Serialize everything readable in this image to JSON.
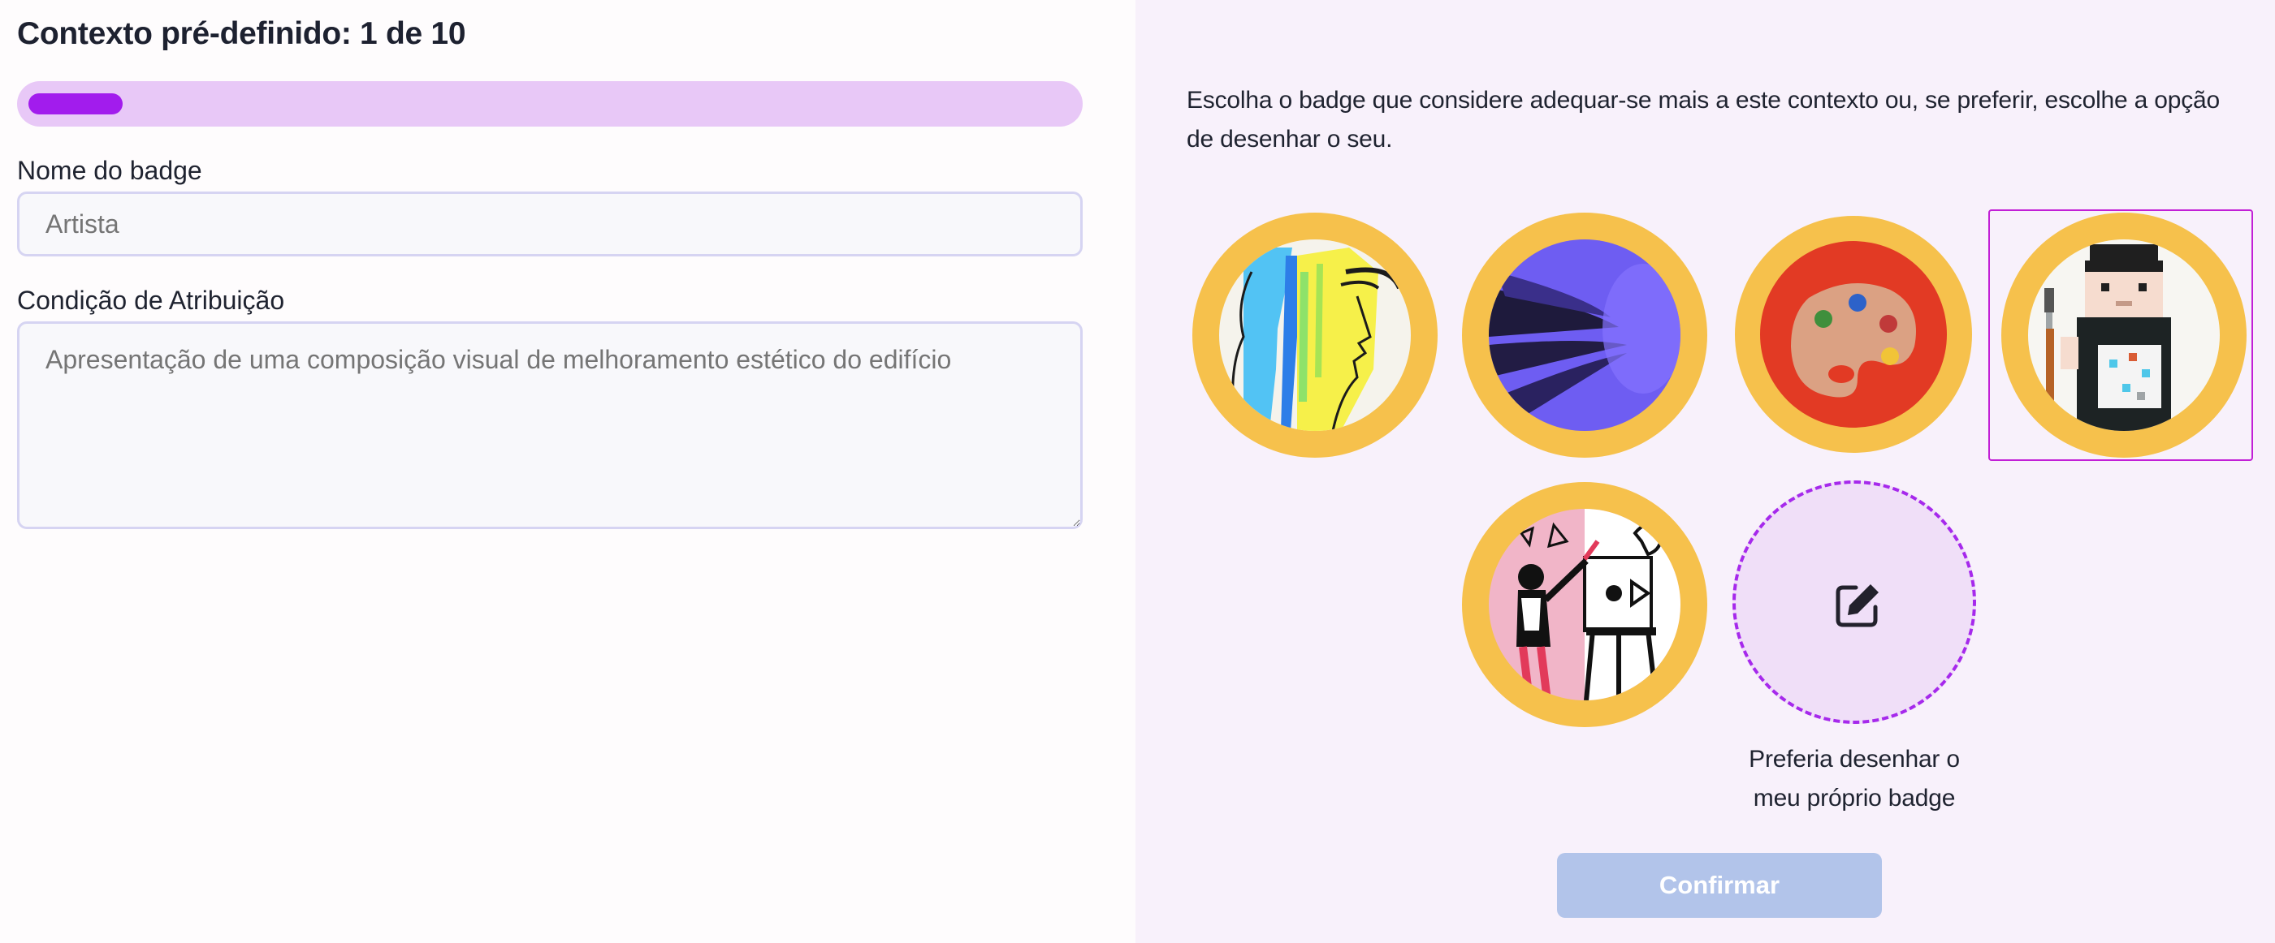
{
  "header": {
    "title": "Contexto pré-definido: 1 de 10"
  },
  "progress": {
    "current": 1,
    "total": 10,
    "fraction": 0.1,
    "track_color": "#e8c8f7",
    "fill_color": "#a21ced"
  },
  "form": {
    "name_label": "Nome do badge",
    "name_placeholder": "Artista",
    "name_value": "",
    "condition_label": "Condição de Atribuição",
    "condition_placeholder": "Apresentação de uma composição visual de melhoramento estético do edifício",
    "condition_value": ""
  },
  "chooser": {
    "instructions": "Escolha o badge que considere adequar-se mais a este contexto ou, se preferir, escolhe a opção de desenhar o seu.",
    "badges": [
      {
        "icon": "abstract-face-icon",
        "selected": false
      },
      {
        "icon": "purple-abstract-icon",
        "selected": false
      },
      {
        "icon": "paint-palette-icon",
        "selected": false
      },
      {
        "icon": "pixel-painter-icon",
        "selected": true
      },
      {
        "icon": "artist-painting-icon",
        "selected": false
      }
    ],
    "draw_own_caption": "Preferia desenhar o meu próprio badge",
    "draw_own_icon": "edit-icon",
    "badge_ring_color": "#f6c14c",
    "selection_color": "#c21fd6"
  },
  "actions": {
    "confirm_label": "Confirmar",
    "confirm_color": "#b2c4ea"
  }
}
